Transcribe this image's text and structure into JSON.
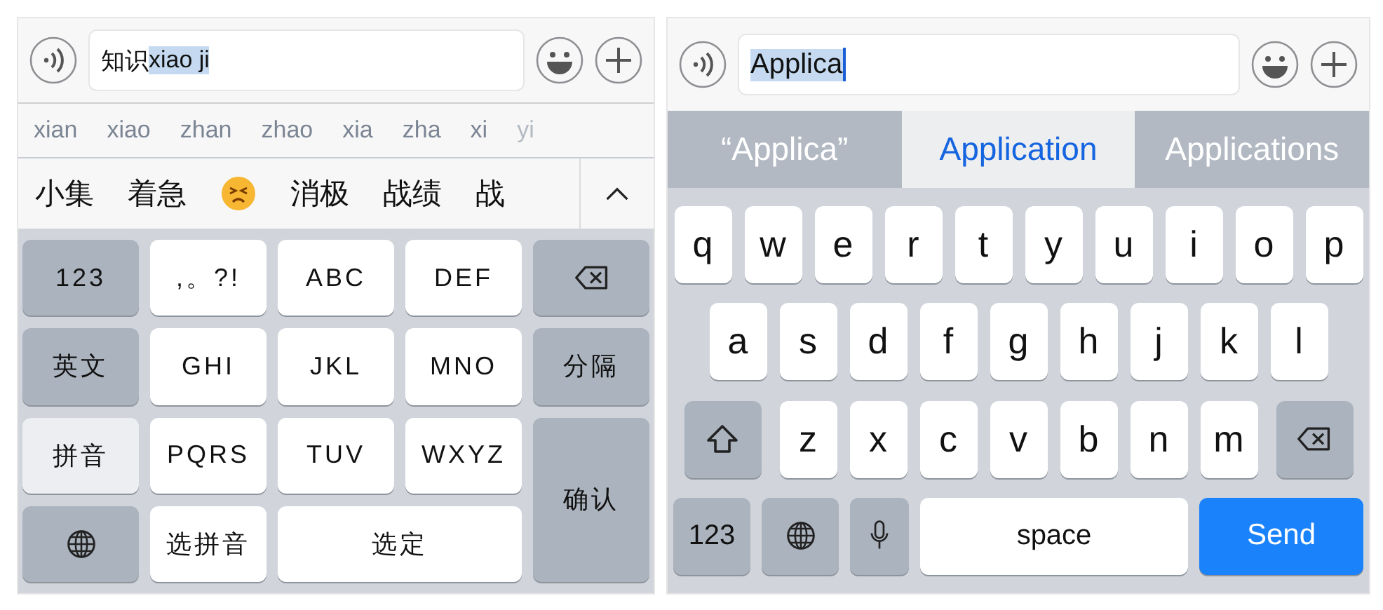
{
  "pinyin_panel": {
    "input": {
      "committed": "知识",
      "composing": "xiao ji"
    },
    "spellings": [
      {
        "text": "xian",
        "faded": false
      },
      {
        "text": "xiao",
        "faded": false
      },
      {
        "text": "zhan",
        "faded": false
      },
      {
        "text": "zhao",
        "faded": false
      },
      {
        "text": "xia",
        "faded": false
      },
      {
        "text": "zha",
        "faded": false
      },
      {
        "text": "xi",
        "faded": false
      },
      {
        "text": "yi",
        "faded": true
      }
    ],
    "candidates": [
      {
        "kind": "word",
        "text": "小集"
      },
      {
        "kind": "word",
        "text": "着急"
      },
      {
        "kind": "emoji"
      },
      {
        "kind": "word",
        "text": "消极"
      },
      {
        "kind": "word",
        "text": "战绩"
      },
      {
        "kind": "word",
        "text": "战"
      }
    ],
    "keys": [
      {
        "kind": "func",
        "label": "123"
      },
      {
        "kind": "char",
        "label": ",。?!"
      },
      {
        "kind": "char",
        "label": "ABC"
      },
      {
        "kind": "char",
        "label": "DEF"
      },
      {
        "kind": "delete"
      },
      {
        "kind": "func",
        "label": "英文"
      },
      {
        "kind": "char",
        "label": "GHI"
      },
      {
        "kind": "char",
        "label": "JKL"
      },
      {
        "kind": "char",
        "label": "MNO"
      },
      {
        "kind": "func",
        "label": "分隔"
      },
      {
        "kind": "mode",
        "label": "拼音",
        "selected": true
      },
      {
        "kind": "char",
        "label": "PQRS"
      },
      {
        "kind": "char",
        "label": "TUV"
      },
      {
        "kind": "char",
        "label": "WXYZ"
      },
      {
        "kind": "confirm",
        "label": "确认"
      },
      {
        "kind": "globe"
      },
      {
        "kind": "char",
        "label": "选拼音"
      },
      {
        "kind": "select",
        "label": "选定"
      }
    ]
  },
  "english_panel": {
    "input": {
      "composing": "Applica"
    },
    "suggestions": [
      {
        "text": "“Applica”",
        "selected": false
      },
      {
        "text": "Application",
        "selected": true
      },
      {
        "text": "Applications",
        "selected": false
      }
    ],
    "rows": [
      {
        "keys": [
          {
            "kind": "char",
            "label": "q"
          },
          {
            "kind": "char",
            "label": "w"
          },
          {
            "kind": "char",
            "label": "e"
          },
          {
            "kind": "char",
            "label": "r"
          },
          {
            "kind": "char",
            "label": "t"
          },
          {
            "kind": "char",
            "label": "y"
          },
          {
            "kind": "char",
            "label": "u"
          },
          {
            "kind": "char",
            "label": "i"
          },
          {
            "kind": "char",
            "label": "o"
          },
          {
            "kind": "char",
            "label": "p"
          }
        ]
      },
      {
        "keys": [
          {
            "kind": "char",
            "label": "a"
          },
          {
            "kind": "char",
            "label": "s"
          },
          {
            "kind": "char",
            "label": "d"
          },
          {
            "kind": "char",
            "label": "f"
          },
          {
            "kind": "char",
            "label": "g"
          },
          {
            "kind": "char",
            "label": "h"
          },
          {
            "kind": "char",
            "label": "j"
          },
          {
            "kind": "char",
            "label": "k"
          },
          {
            "kind": "char",
            "label": "l"
          }
        ]
      },
      {
        "keys": [
          {
            "kind": "shift"
          },
          {
            "kind": "char",
            "label": "z"
          },
          {
            "kind": "char",
            "label": "x"
          },
          {
            "kind": "char",
            "label": "c"
          },
          {
            "kind": "char",
            "label": "v"
          },
          {
            "kind": "char",
            "label": "b"
          },
          {
            "kind": "char",
            "label": "n"
          },
          {
            "kind": "char",
            "label": "m"
          },
          {
            "kind": "delete"
          }
        ]
      },
      {
        "keys": [
          {
            "kind": "func",
            "label": "123"
          },
          {
            "kind": "globe"
          },
          {
            "kind": "mic"
          },
          {
            "kind": "space",
            "label": "space"
          },
          {
            "kind": "send",
            "label": "Send"
          }
        ]
      }
    ]
  }
}
